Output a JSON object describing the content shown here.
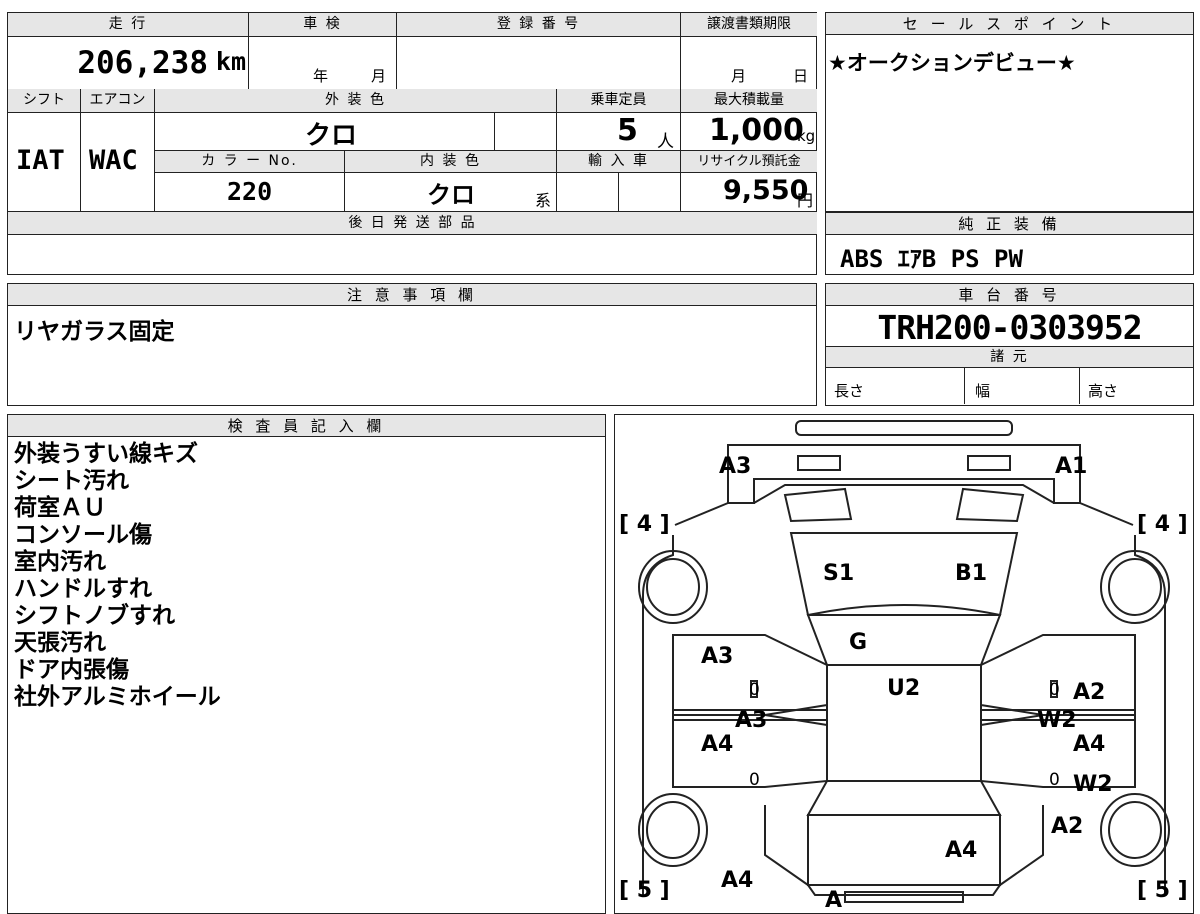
{
  "vehicle": {
    "mileage_label": "走 行",
    "mileage_value": "206,238",
    "mileage_unit": "km",
    "shaken_label": "車 検",
    "shaken_year_unit": "年",
    "shaken_month_unit": "月",
    "reg_label": "登 録 番 号",
    "deadline_label": "譲渡書類期限",
    "deadline_month_unit": "月",
    "deadline_day_unit": "日",
    "shift_label": "シフト",
    "shift_value": "IAT",
    "ac_label": "エアコン",
    "ac_value": "WAC",
    "exterior_label": "外 装 色",
    "exterior_value": "クロ",
    "capacity_label": "乗車定員",
    "capacity_value": "5",
    "capacity_unit": "人",
    "maxload_label": "最大積載量",
    "maxload_value": "1,000",
    "maxload_unit": "kg",
    "color_no_label": "カ ラ ー No.",
    "color_no_value": "220",
    "interior_label": "内 装 色",
    "interior_value": "クロ",
    "interior_unit": "系",
    "import_label": "輸 入 車",
    "recycle_label": "リサイクル預託金",
    "recycle_value": "9,550",
    "recycle_unit": "円",
    "later_parts_label": "後 日 発 送 部 品"
  },
  "sales_point": {
    "label": "セ ー ル ス ポ イ ン ト",
    "text": "★オークションデビュー★"
  },
  "equipment": {
    "label": "純 正 装 備",
    "text": "ABS ｴｱB PS PW"
  },
  "caution": {
    "label": "注 意 事 項 欄",
    "text": "リヤガラス固定"
  },
  "chassis": {
    "label": "車 台 番 号",
    "value": "TRH200-0303952",
    "spec_label": "諸 元",
    "length_label": "長さ",
    "width_label": "幅",
    "height_label": "高さ"
  },
  "inspector": {
    "label": "検 査 員 記 入 欄",
    "notes": [
      "外装うすい線キズ",
      "シート汚れ",
      "荷室ＡＵ",
      "コンソール傷",
      "室内汚れ",
      "ハンドルすれ",
      "シフトノブすれ",
      "天張汚れ",
      "ドア内張傷",
      "社外アルミホイール"
    ]
  },
  "diagram": {
    "tire_front_left": "[ 4 ]",
    "tire_front_right": "[ 4 ]",
    "tire_rear_left": "[ 5 ]",
    "tire_rear_right": "[ 5 ]",
    "marks": {
      "front_left": "A3",
      "front_right": "A1",
      "seat": "S1",
      "seat_right": "B1",
      "glass": "G",
      "roof": "U2",
      "door_fl": "A3",
      "door_fl_b": "A3",
      "door_rl": "A4",
      "door_fr": "A2",
      "door_fr_b": "W2",
      "door_rr": "A4",
      "door_rr_b": "W2",
      "zero1": "0",
      "zero2": "0",
      "zero3": "0",
      "zero4": "0",
      "rear_right": "A2",
      "rear": "A4",
      "rear_left": "A4",
      "rear_bottom": "A"
    }
  }
}
